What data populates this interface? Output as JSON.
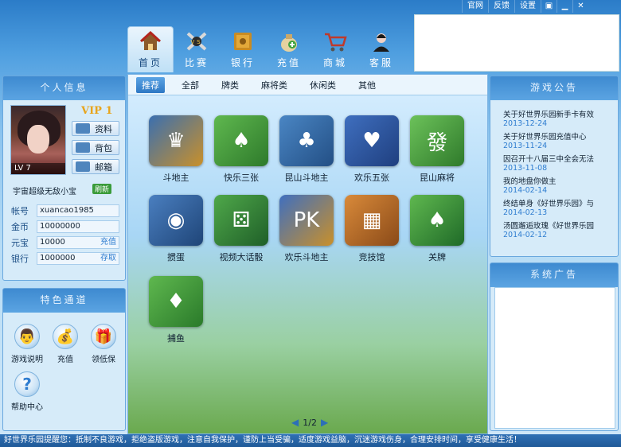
{
  "topbar": {
    "links": [
      "官网",
      "反馈",
      "设置"
    ],
    "icons": [
      "lock-icon",
      "minimize-icon",
      "close-icon"
    ]
  },
  "nav": [
    {
      "label": "首页",
      "icon": "home-icon",
      "active": true
    },
    {
      "label": "比赛",
      "icon": "crossed-swords-icon",
      "active": false
    },
    {
      "label": "银行",
      "icon": "safe-icon",
      "active": false
    },
    {
      "label": "充值",
      "icon": "money-bag-icon",
      "active": false
    },
    {
      "label": "商城",
      "icon": "shopping-cart-icon",
      "active": false
    },
    {
      "label": "客服",
      "icon": "agent-icon",
      "active": false
    }
  ],
  "left_info": {
    "title": "个人信息",
    "level": "LV 7",
    "vip": "VIP 1",
    "buttons": [
      "资料",
      "背包",
      "邮箱"
    ],
    "nickname": "宇宙超级无敌小宝",
    "refresh": "刷新",
    "rows": [
      {
        "label": "帐号",
        "value": "xuancao1985",
        "action": ""
      },
      {
        "label": "金币",
        "value": "10000000",
        "action": ""
      },
      {
        "label": "元宝",
        "value": "10000",
        "action": "充值"
      },
      {
        "label": "银行",
        "value": "1000000",
        "action": "存取"
      }
    ]
  },
  "features": {
    "title": "特色通道",
    "items": [
      {
        "label": "游戏说明",
        "icon": "guide-icon"
      },
      {
        "label": "充值",
        "icon": "coins-icon"
      },
      {
        "label": "领低保",
        "icon": "gift-icon"
      },
      {
        "label": "帮助中心",
        "icon": "question-icon"
      }
    ]
  },
  "tabs": [
    "推荐",
    "全部",
    "牌类",
    "麻将类",
    "休闲类",
    "其他"
  ],
  "games": [
    {
      "name": "斗地主",
      "icon": "landlord-icon",
      "color": "#c9902a"
    },
    {
      "name": "快乐三张",
      "icon": "three-cards-icon",
      "color": "#3e9a3a"
    },
    {
      "name": "昆山斗地主",
      "icon": "kunshan-landlord-icon",
      "color": "#2f6fa8"
    },
    {
      "name": "欢乐五张",
      "icon": "five-cards-icon",
      "color": "#2b4f9a"
    },
    {
      "name": "昆山麻将",
      "icon": "mahjong-tile-icon",
      "color": "#4c9a3f"
    },
    {
      "name": "掼蛋",
      "icon": "egg-runner-icon",
      "color": "#2f5f9a"
    },
    {
      "name": "视频大话骰",
      "icon": "dice-mahjong-icon",
      "color": "#2f7a3a"
    },
    {
      "name": "欢乐斗地主",
      "icon": "pk-landlord-icon",
      "color": "#2a4f8f"
    },
    {
      "name": "竞技馆",
      "icon": "arena-tiles-icon",
      "color": "#b86b28"
    },
    {
      "name": "关牌",
      "icon": "hand-cards-icon",
      "color": "#2f8a3a"
    },
    {
      "name": "捕鱼",
      "icon": "fish-cards-icon",
      "color": "#3c8f3c"
    }
  ],
  "pager": {
    "text": "1/2"
  },
  "notice": {
    "title": "游戏公告",
    "items": [
      {
        "title": "关于好世界乐园新手卡有效",
        "date": "2013-12-24"
      },
      {
        "title": "关于好世界乐园充值中心",
        "date": "2013-11-24"
      },
      {
        "title": "因召开十八届三中全会无法",
        "date": "2013-11-08"
      },
      {
        "title": "我的地盘你做主",
        "date": "2014-02-14"
      },
      {
        "title": "终结单身《好世界乐园》与",
        "date": "2014-02-13"
      },
      {
        "title": "汤圆邂逅玫瑰《好世界乐园",
        "date": "2014-02-12"
      }
    ]
  },
  "ad": {
    "title": "系统广告"
  },
  "ticker": "好世界乐园提醒您：抵制不良游戏，拒绝盗版游戏，注意自我保护，谨防上当受骗，适度游戏益脑，沉迷游戏伤身，合理安排时间，享受健康生活！"
}
